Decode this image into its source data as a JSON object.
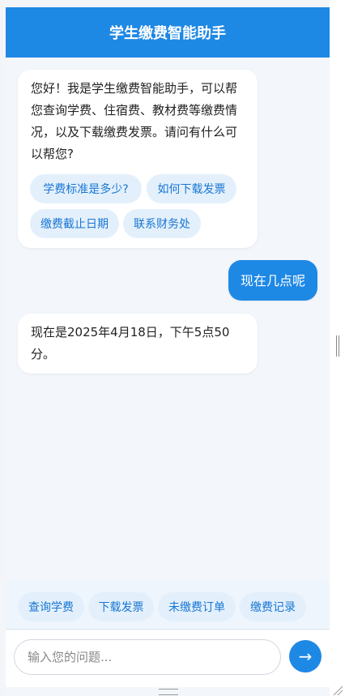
{
  "header": {
    "title": "学生缴费智能助手"
  },
  "messages": {
    "bot_welcome": "您好！我是学生缴费智能助手，可以帮您查询学费、住宿费、教材费等缴费情况，以及下载缴费发票。请问有什么可以帮您?",
    "bot_welcome_chips": [
      "学费标准是多少?",
      "如何下载发票",
      "缴费截止日期",
      "联系财务处"
    ],
    "user_1": "现在几点呢",
    "bot_reply": "现在是2025年4月18日，下午5点50分。"
  },
  "quick_actions": [
    "查询学费",
    "下载发票",
    "未缴费订单",
    "缴费记录"
  ],
  "input": {
    "placeholder": "输入您的问题..."
  },
  "send_button": {
    "icon": "arrow-right-icon",
    "glyph": "→"
  },
  "colors": {
    "primary": "#1e88e5",
    "chip_bg": "#e3f0fc",
    "chip_text": "#1976d2",
    "background": "#f3f6fb"
  }
}
